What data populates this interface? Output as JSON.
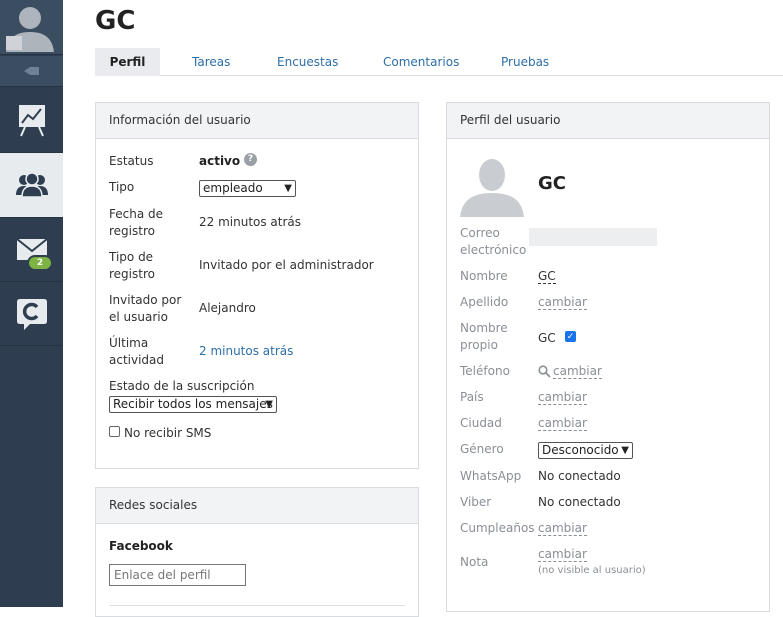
{
  "page": {
    "title": "GC"
  },
  "sidebar": {
    "messages_badge": "2"
  },
  "tabs": [
    "Perfil",
    "Tareas",
    "Encuestas",
    "Comentarios",
    "Pruebas"
  ],
  "user_info": {
    "header": "Información del usuario",
    "status_label": "Estatus",
    "status_value": "activo",
    "type_label": "Tipo",
    "type_value": "empleado",
    "reg_date_label": "Fecha de registro",
    "reg_date_value": "22 minutos atrás",
    "reg_type_label": "Tipo de registro",
    "reg_type_value": "Invitado por el administrador",
    "invited_label": "Invitado por el usuario",
    "invited_value": "Alejandro",
    "last_activity_label": "Última actividad",
    "last_activity_value": "2 minutos atrás",
    "subscription_label": "Estado de la suscripción",
    "subscription_value": "Recibir todos los mensajes",
    "no_sms_label": "No recibir SMS"
  },
  "social": {
    "header": "Redes sociales",
    "facebook_label": "Facebook",
    "profile_placeholder": "Enlace del perfil"
  },
  "profile": {
    "header": "Perfil del usuario",
    "name_display": "GC",
    "email_label": "Correo electrónico",
    "first_name_label": "Nombre",
    "first_name_value": "GC",
    "last_name_label": "Apellido",
    "change": "cambiar",
    "own_name_label": "Nombre propio",
    "own_name_value": "GC",
    "phone_label": "Teléfono",
    "country_label": "País",
    "city_label": "Ciudad",
    "gender_label": "Género",
    "gender_value": "Desconocido",
    "whatsapp_label": "WhatsApp",
    "whatsapp_value": "No conectado",
    "viber_label": "Viber",
    "viber_value": "No conectado",
    "birthday_label": "Cumpleaños",
    "note_label": "Nota",
    "note_hint": "(no visible al usuario)"
  },
  "colors": {
    "sidebar": "#2e3e50",
    "link": "#2d6fa8",
    "badge": "#7cb342"
  }
}
